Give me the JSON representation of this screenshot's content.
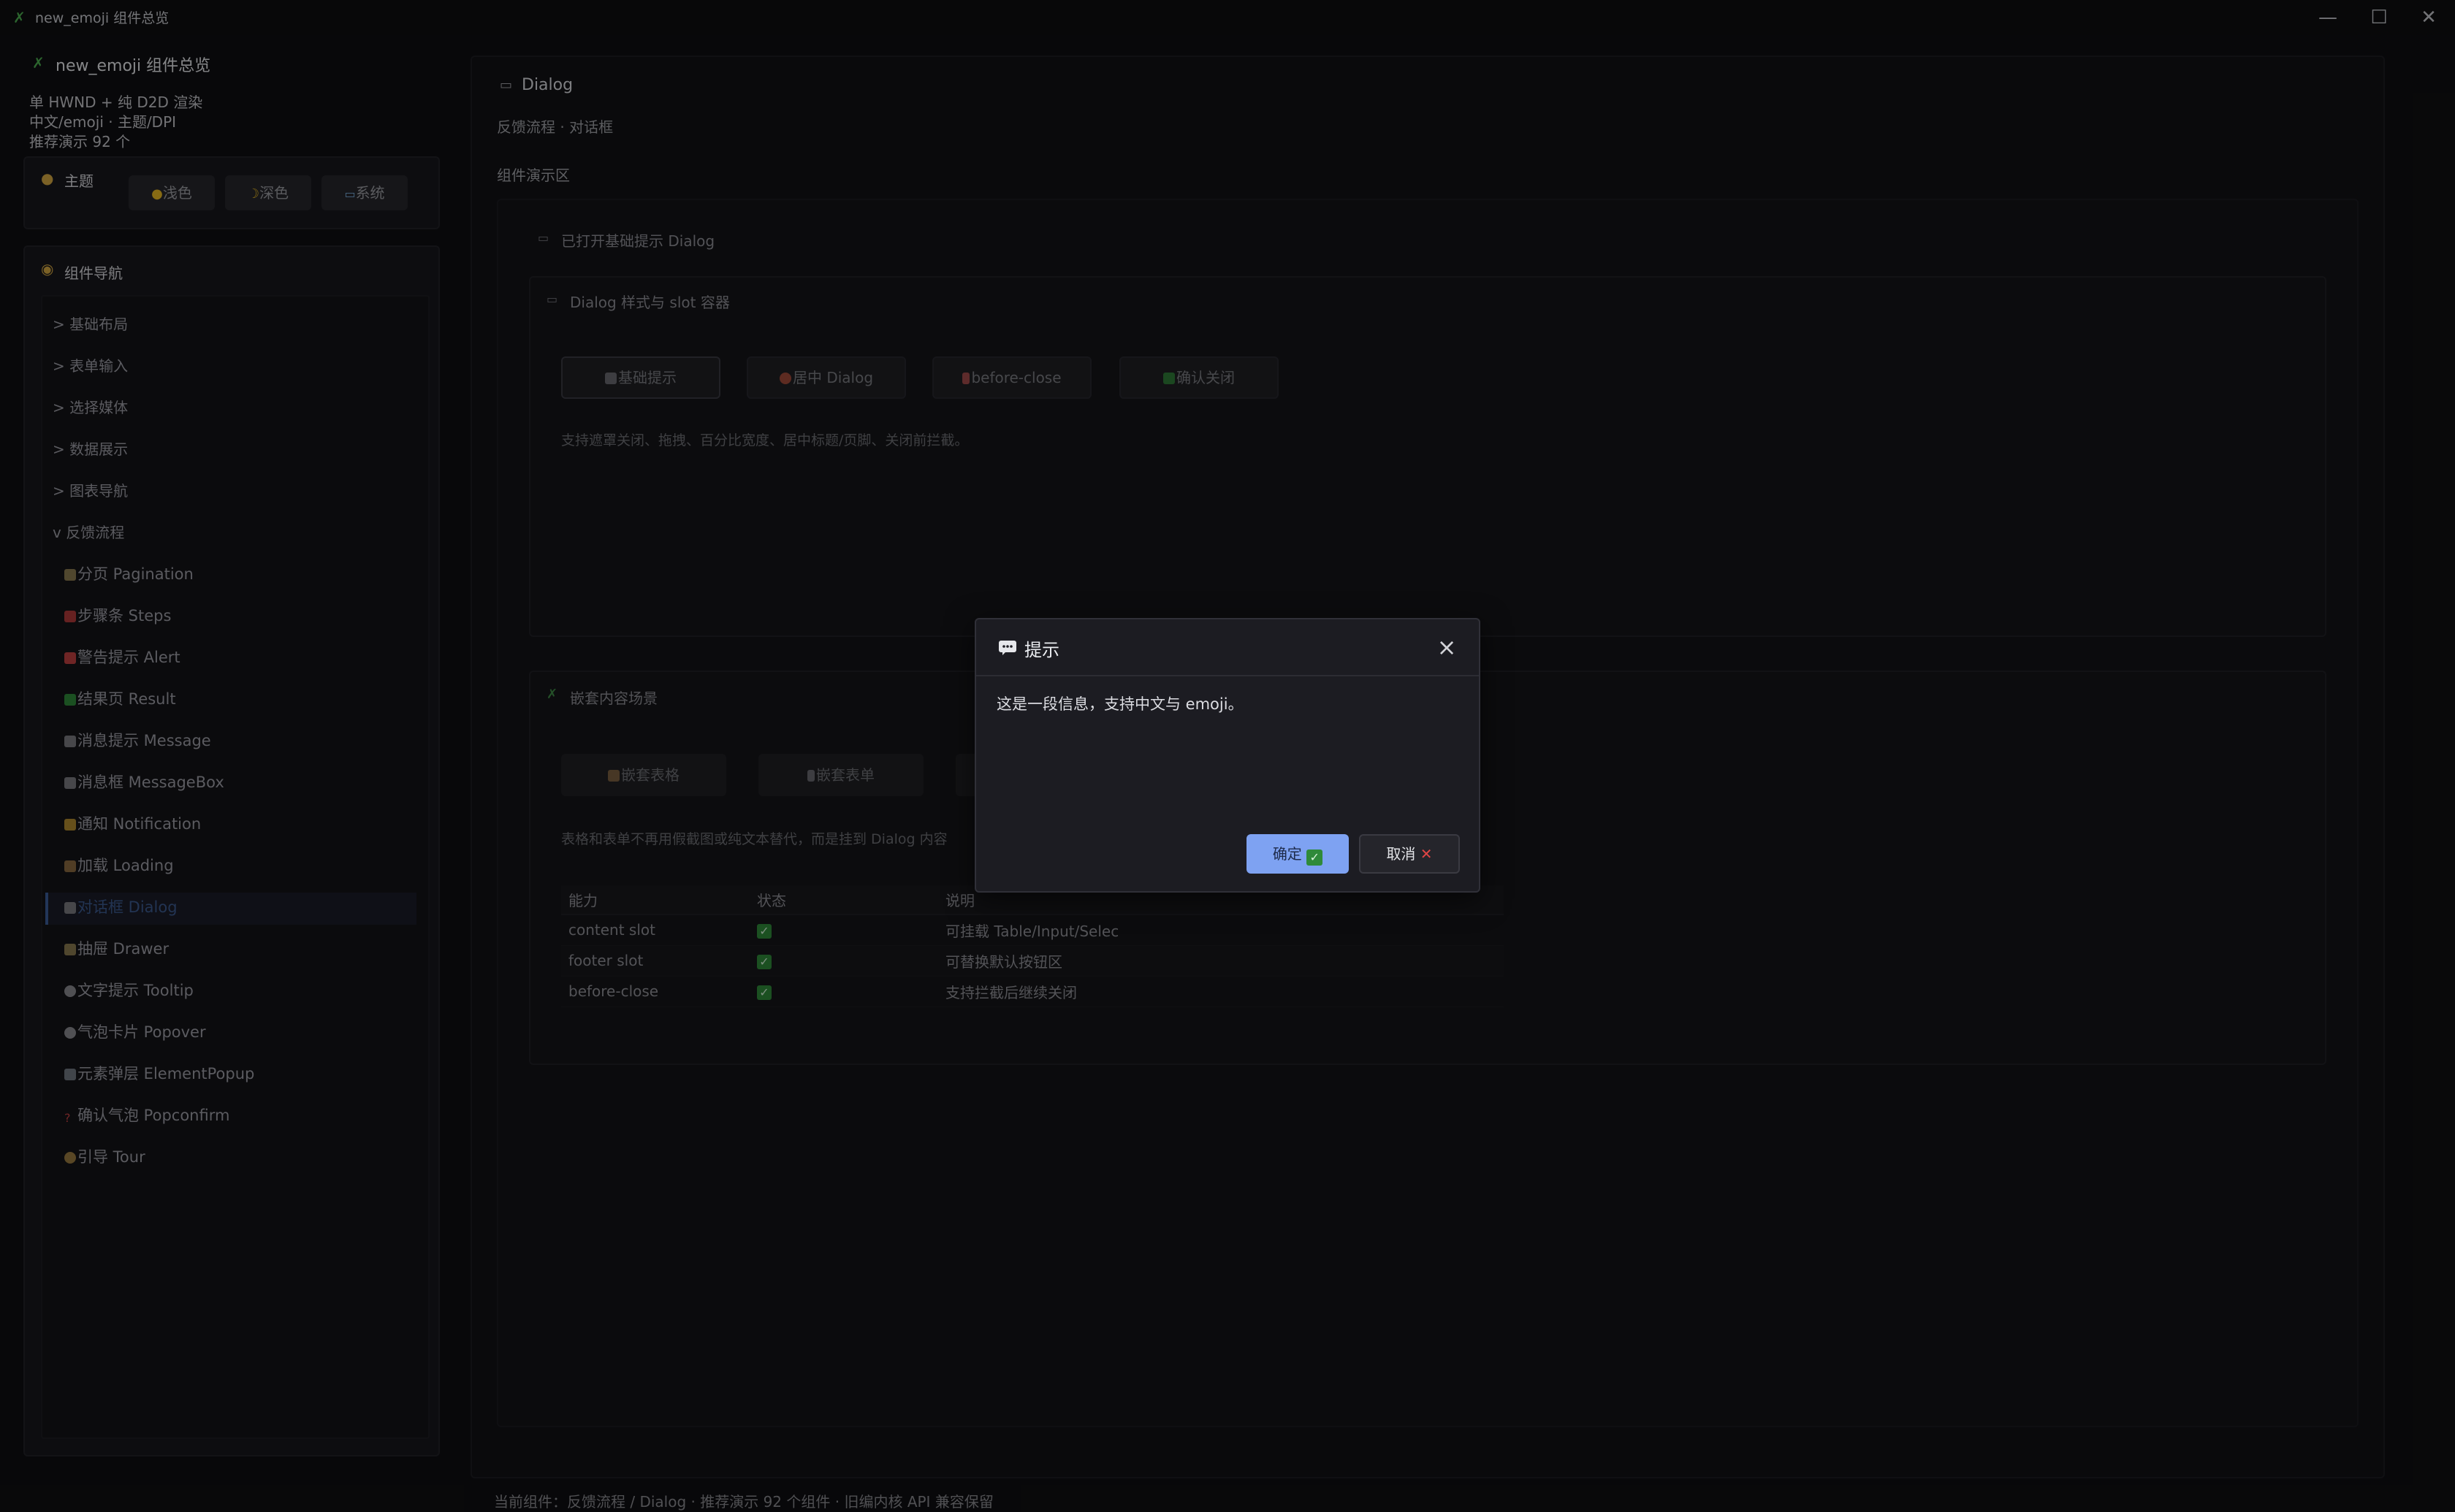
{
  "window": {
    "title": "new_emoji 组件总览",
    "minimize": "—",
    "maximize": "☐",
    "close": "✕"
  },
  "sidebar": {
    "app_name": "new_emoji 组件总览",
    "info_lines": [
      "单 HWND + 纯 D2D 渲染",
      "中文/emoji · 主题/DPI",
      "推荐演示 92 个"
    ],
    "theme": {
      "label": "主题",
      "buttons": [
        "浅色",
        "深色",
        "系统"
      ]
    },
    "nav": {
      "title": "组件导航",
      "groups": [
        {
          "label": "> 基础布局"
        },
        {
          "label": "> 表单输入"
        },
        {
          "label": "> 选择媒体"
        },
        {
          "label": "> 数据展示"
        },
        {
          "label": "> 图表导航"
        },
        {
          "label": "v 反馈流程"
        }
      ],
      "items": [
        {
          "label": "分页 Pagination"
        },
        {
          "label": "步骤条 Steps"
        },
        {
          "label": "警告提示 Alert"
        },
        {
          "label": "结果页 Result"
        },
        {
          "label": "消息提示 Message"
        },
        {
          "label": "消息框 MessageBox"
        },
        {
          "label": "通知 Notification"
        },
        {
          "label": "加载 Loading"
        },
        {
          "label": "对话框 Dialog"
        },
        {
          "label": "抽屉 Drawer"
        },
        {
          "label": "文字提示 Tooltip"
        },
        {
          "label": "气泡卡片 Popover"
        },
        {
          "label": "元素弹层 ElementPopup"
        },
        {
          "label": "确认气泡 Popconfirm"
        },
        {
          "label": "引导 Tour"
        }
      ],
      "active_index": 8
    }
  },
  "main": {
    "title": "Dialog",
    "subtitle": "反馈流程 · 对话框",
    "demo_label": "组件演示区",
    "opened_label": "已打开基础提示 Dialog",
    "card1": {
      "title": "Dialog 样式与 slot 容器",
      "buttons": [
        "基础提示",
        "居中 Dialog",
        "before-close",
        "确认关闭"
      ],
      "desc": "支持遮罩关闭、拖拽、百分比宽度、居中标题/页脚、关闭前拦截。"
    },
    "card2": {
      "title": "嵌套内容场景",
      "buttons": [
        "嵌套表格",
        "嵌套表单"
      ],
      "desc": "表格和表单不再用假截图或纯文本替代，而是挂到 Dialog 内容"
    },
    "table": {
      "headers": [
        "能力",
        "状态",
        "说明"
      ],
      "rows": [
        {
          "cap": "content slot",
          "desc": "可挂载 Table/Input/Selec"
        },
        {
          "cap": "footer slot",
          "desc": "可替换默认按钮区"
        },
        {
          "cap": "before-close",
          "desc": "支持拦截后继续关闭"
        }
      ]
    },
    "status_bar": "当前组件：反馈流程 / Dialog · 推荐演示 92 个组件 · 旧编内核 API 兼容保留"
  },
  "dialog": {
    "title": "提示",
    "content": "这是一段信息，支持中文与 emoji。",
    "ok_label": "确定",
    "cancel_label": "取消"
  },
  "colors": {
    "accent": "#7ea2f2",
    "success": "#2f8a3a",
    "danger": "#e04545",
    "background": "#0f0f12"
  }
}
